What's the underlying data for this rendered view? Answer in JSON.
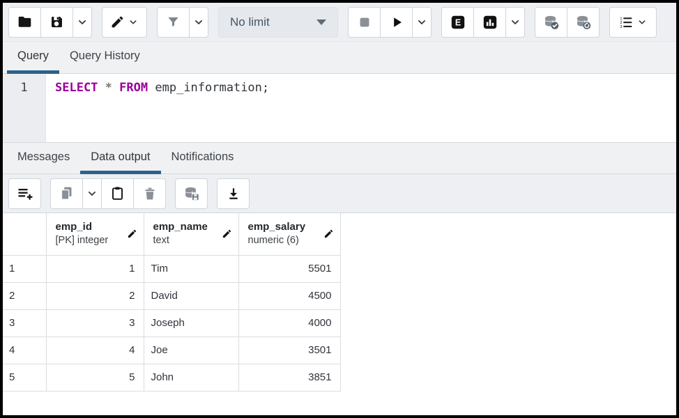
{
  "toolbar": {
    "limit_select": {
      "value": "No limit"
    },
    "buttons": [
      "open-file",
      "save",
      "save-options",
      "edit-menu",
      "filter",
      "filter-options",
      "row-limit",
      "stop",
      "execute",
      "execute-options",
      "explain",
      "explain-analyze",
      "explain-options",
      "commit",
      "rollback",
      "macros"
    ]
  },
  "editor_tabs": [
    {
      "label": "Query",
      "active": true
    },
    {
      "label": "Query History",
      "active": false
    }
  ],
  "editor": {
    "line_number": "1",
    "sql_keyword_1": "SELECT",
    "sql_operator": "*",
    "sql_keyword_2": "FROM",
    "sql_rest": "emp_information;"
  },
  "output_tabs": [
    {
      "label": "Messages",
      "active": false
    },
    {
      "label": "Data output",
      "active": true
    },
    {
      "label": "Notifications",
      "active": false
    }
  ],
  "data_toolbar": {
    "buttons": [
      "add-row",
      "copy",
      "copy-options",
      "paste",
      "delete",
      "save-data-changes",
      "download-csv"
    ]
  },
  "grid": {
    "columns": [
      {
        "name": "emp_id",
        "type": "[PK] integer"
      },
      {
        "name": "emp_name",
        "type": "text"
      },
      {
        "name": "emp_salary",
        "type": "numeric (6)"
      }
    ],
    "rows": [
      {
        "row_num": "1",
        "emp_id": "1",
        "emp_name": "Tim",
        "emp_salary": "5501"
      },
      {
        "row_num": "2",
        "emp_id": "2",
        "emp_name": "David",
        "emp_salary": "4500"
      },
      {
        "row_num": "3",
        "emp_id": "3",
        "emp_name": "Joseph",
        "emp_salary": "4000"
      },
      {
        "row_num": "4",
        "emp_id": "4",
        "emp_name": "Joe",
        "emp_salary": "3501"
      },
      {
        "row_num": "5",
        "emp_id": "5",
        "emp_name": "John",
        "emp_salary": "3851"
      }
    ]
  },
  "colors": {
    "accent_underline": "#2e618c",
    "sql_keyword": "#990099",
    "icon_active": "#151515",
    "icon_disabled": "#8a9096"
  }
}
